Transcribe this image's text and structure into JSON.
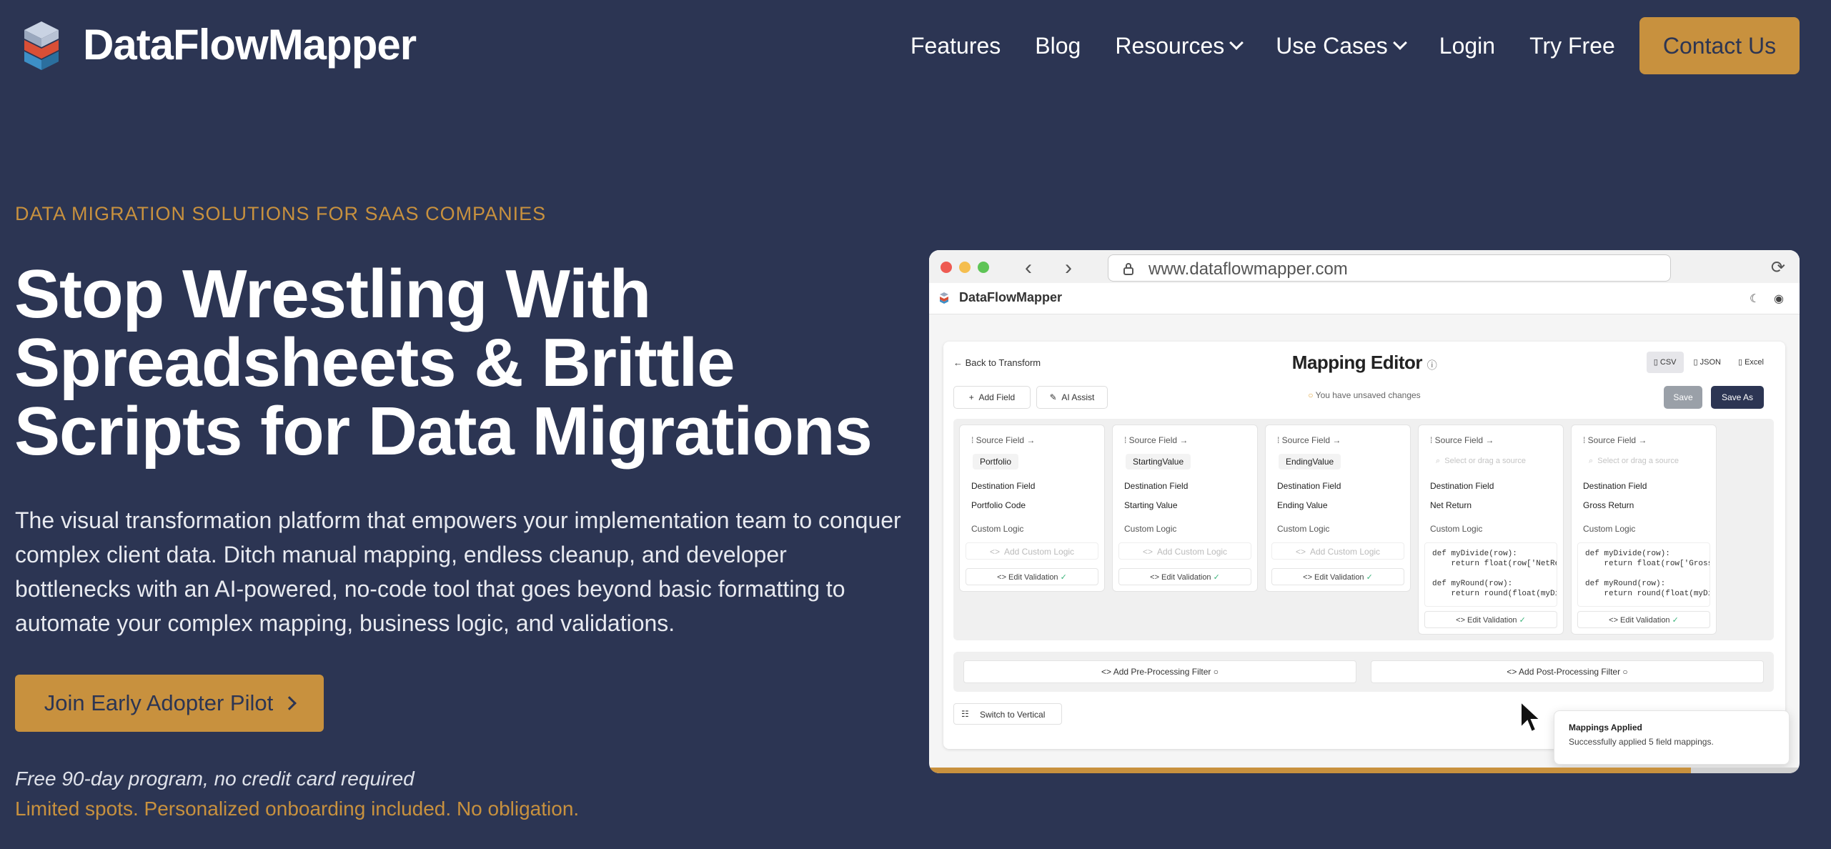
{
  "brand": {
    "name": "DataFlowMapper",
    "accent": "#c8913e",
    "background": "#2c3553"
  },
  "nav": {
    "links": [
      {
        "label": "Features",
        "dropdown": false
      },
      {
        "label": "Blog",
        "dropdown": false
      },
      {
        "label": "Resources",
        "dropdown": true
      },
      {
        "label": "Use Cases",
        "dropdown": true
      },
      {
        "label": "Login",
        "dropdown": false
      },
      {
        "label": "Try Free",
        "dropdown": false
      }
    ],
    "contact_label": "Contact Us"
  },
  "hero": {
    "eyebrow": "DATA MIGRATION SOLUTIONS FOR SAAS COMPANIES",
    "headline_line1": "Stop Wrestling With",
    "headline_line2": "Spreadsheets & Brittle",
    "headline_line3": "Scripts for Data Migrations",
    "description": "The visual transformation platform that empowers your implementation team to conquer complex client data. Ditch manual mapping, endless cleanup, and developer bottlenecks with an AI-powered, no-code tool that goes beyond basic formatting to automate your complex mapping, business logic, and validations.",
    "cta_label": "Join Early Adopter Pilot",
    "fine_print_1": "Free 90-day program, no credit card required",
    "fine_print_2": "Limited spots. Personalized onboarding included. No obligation."
  },
  "browser": {
    "url": "www.dataflowmapper.com",
    "app_name": "DataFlowMapper",
    "editor": {
      "back_label": "Back to Transform",
      "title": "Mapping Editor",
      "formats": [
        "CSV",
        "JSON",
        "Excel"
      ],
      "active_format": "CSV",
      "add_field_label": "Add Field",
      "ai_assist_label": "AI Assist",
      "unsaved_text": "You have unsaved changes",
      "save_label": "Save",
      "save_as_label": "Save As",
      "source_field_label": "Source Field",
      "destination_field_label": "Destination Field",
      "custom_logic_label": "Custom Logic",
      "add_custom_logic_label": "Add Custom Logic",
      "edit_validation_label": "Edit Validation",
      "search_placeholder": "Select or drag a source",
      "cards": [
        {
          "source": "Portfolio",
          "destination": "Portfolio Code",
          "code": ""
        },
        {
          "source": "StartingValue",
          "destination": "Starting Value",
          "code": ""
        },
        {
          "source": "EndingValue",
          "destination": "Ending Value",
          "code": ""
        },
        {
          "source": "",
          "destination": "Net Return",
          "code": "def myDivide(row):\n    return float(row['NetRe\n\ndef myRound(row):\n    return round(float(myDi"
        },
        {
          "source": "",
          "destination": "Gross Return",
          "code": "def myDivide(row):\n    return float(row['Gross\n\ndef myRound(row):\n    return round(float(myDi"
        }
      ],
      "pre_filter_label": "Add Pre-Processing Filter",
      "post_filter_label": "Add Post-Processing Filter",
      "switch_label": "Switch to Vertical"
    },
    "toast": {
      "title": "Mappings Applied",
      "message": "Successfully applied 5 field mappings."
    },
    "progress_fraction": 0.875
  }
}
